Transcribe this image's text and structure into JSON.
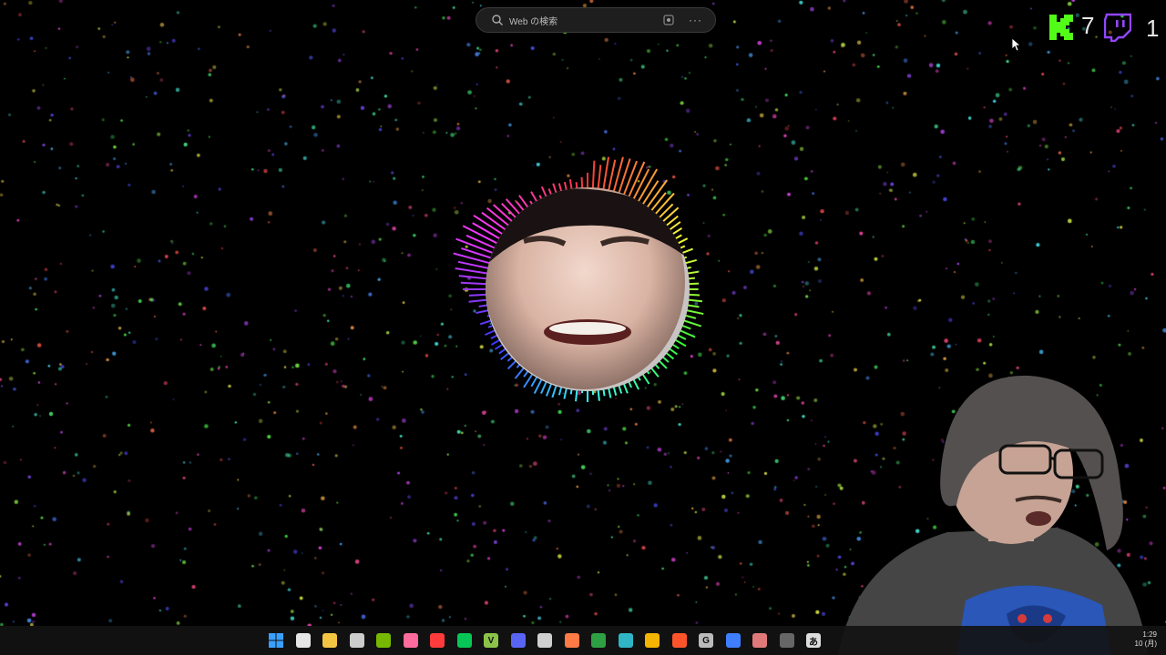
{
  "search": {
    "placeholder": "Web の検索",
    "more": "···"
  },
  "counters": {
    "kick_count": "7",
    "twitch_count": "1"
  },
  "colors": {
    "kick": "#53fc18",
    "twitch": "#9146ff",
    "background": "#000000",
    "search_bg": "#1e1e1e"
  },
  "taskbar": {
    "icons": [
      {
        "name": "start-icon",
        "color": "#3aa0ff"
      },
      {
        "name": "task-view-icon",
        "color": "#e6e6e6"
      },
      {
        "name": "file-explorer-icon",
        "color": "#f4c542"
      },
      {
        "name": "obs-icon",
        "color": "#cccccc"
      },
      {
        "name": "nvidia-icon",
        "color": "#76b900"
      },
      {
        "name": "lips-app-icon",
        "color": "#ff6b9d"
      },
      {
        "name": "record-icon",
        "color": "#ff3b3b"
      },
      {
        "name": "line-icon",
        "color": "#06c755"
      },
      {
        "name": "v-app-icon",
        "color": "#8bc34a",
        "glyph": "V"
      },
      {
        "name": "discord-icon",
        "color": "#5865f2"
      },
      {
        "name": "chatgpt-icon",
        "color": "#cfcfcf"
      },
      {
        "name": "office-app-icon",
        "color": "#ff7a45"
      },
      {
        "name": "xbox-icon",
        "color": "#2ea043"
      },
      {
        "name": "edge-icon",
        "color": "#2fb5c6"
      },
      {
        "name": "chrome-icon",
        "color": "#f4b400"
      },
      {
        "name": "brave-icon",
        "color": "#fb542b"
      },
      {
        "name": "g-app-icon",
        "color": "#bbbbbb",
        "glyph": "G"
      },
      {
        "name": "settings-app-icon",
        "color": "#3f7fff"
      },
      {
        "name": "paint-app-icon",
        "color": "#e07a7a"
      },
      {
        "name": "misc-app-icon",
        "color": "#666666"
      },
      {
        "name": "translate-app-icon",
        "color": "#dddddd",
        "glyph": "あ"
      }
    ]
  },
  "clock": {
    "time": "1:29",
    "date": "10 (月)"
  }
}
